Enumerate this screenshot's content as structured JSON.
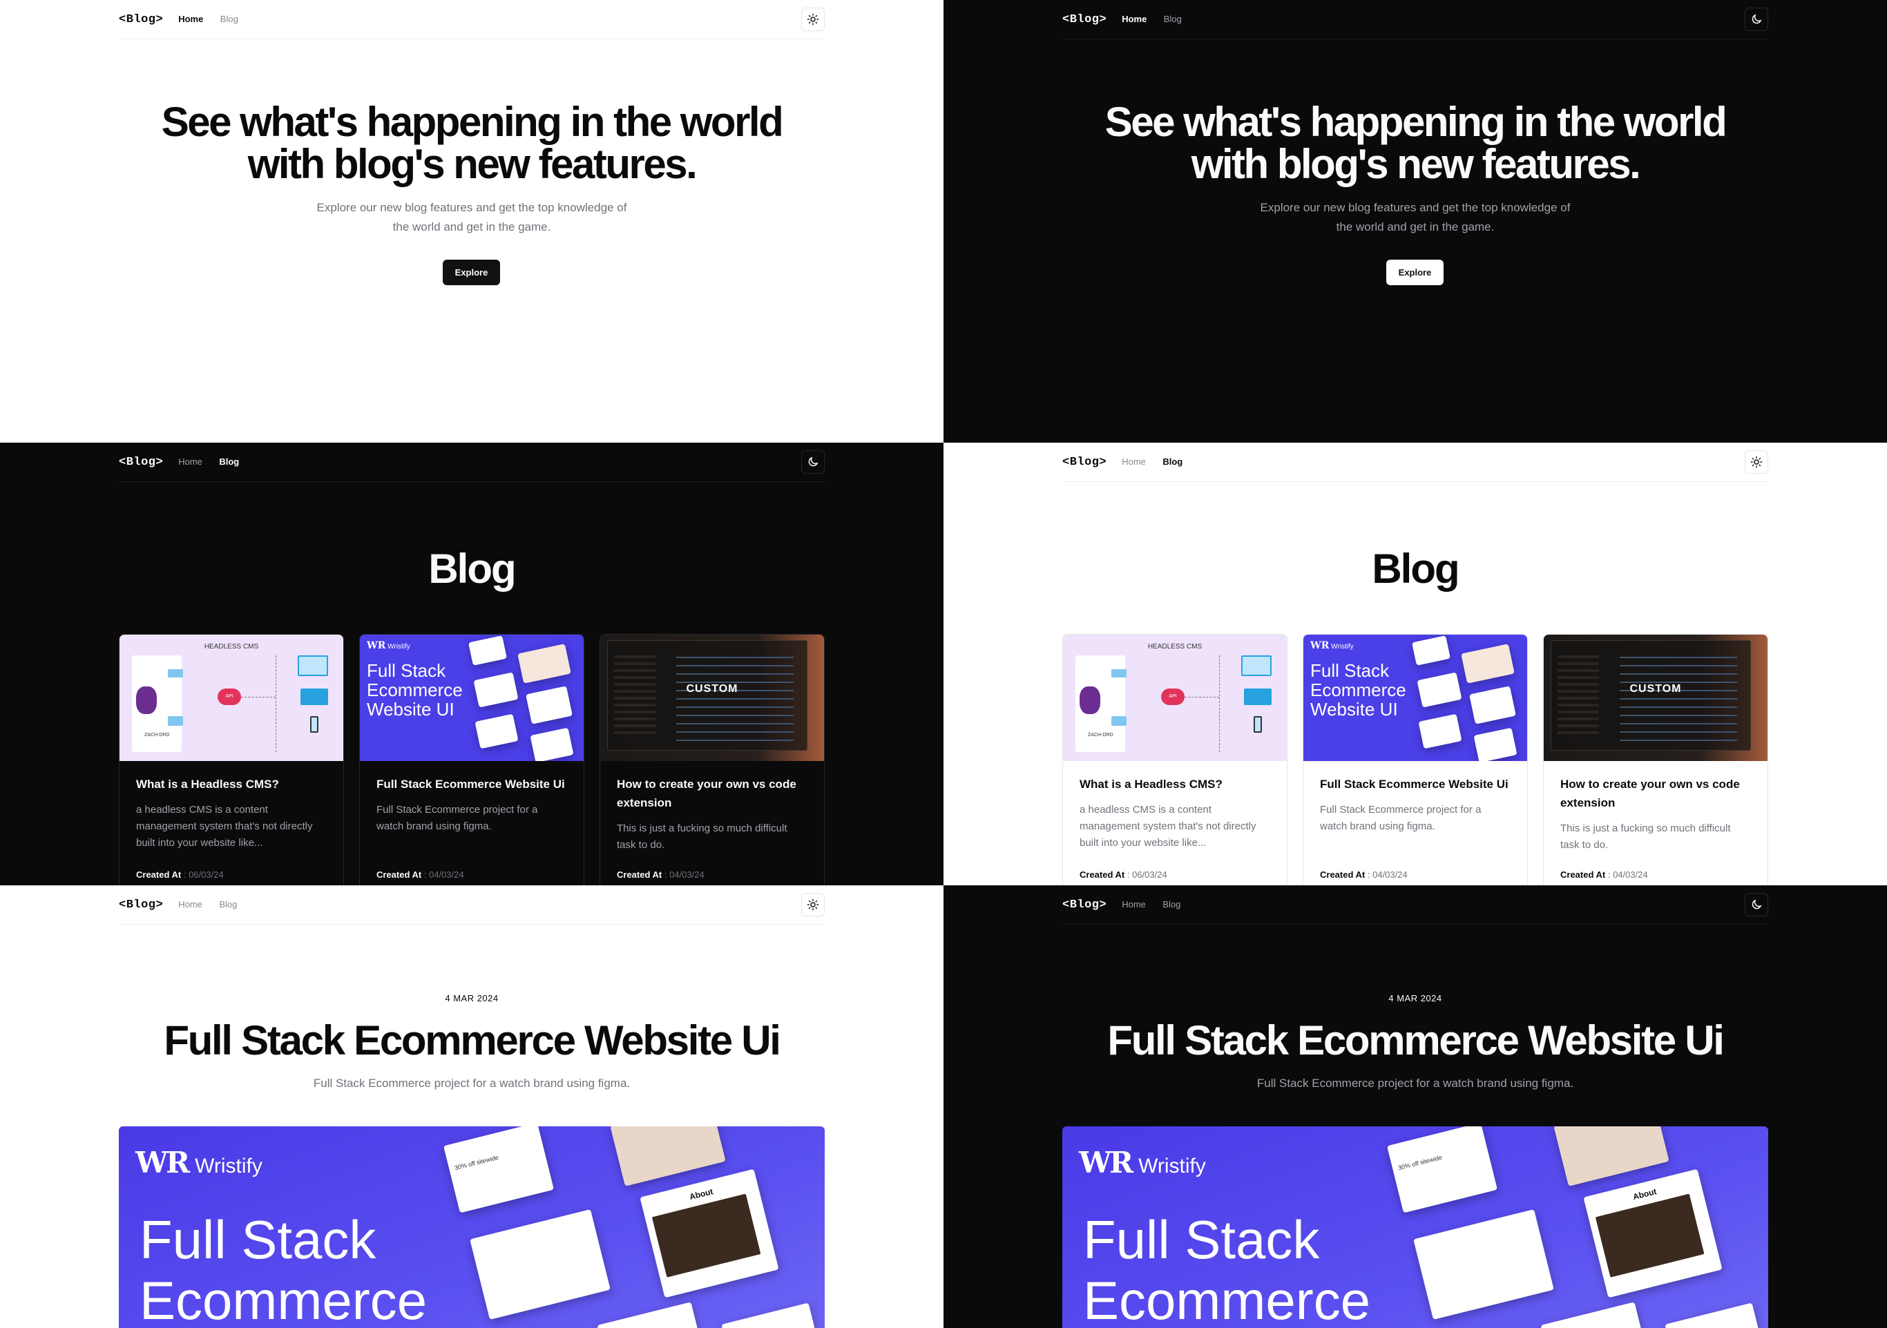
{
  "nav": {
    "logo": "<Blog>",
    "home": "Home",
    "blog": "Blog"
  },
  "hero": {
    "title_line1": "See what's happening in the world",
    "title_line2": "with blog's new features.",
    "sub_line1": "Explore our new blog features and get the top knowledge of",
    "sub_line2": "the world and get in the game.",
    "cta": "Explore"
  },
  "blog": {
    "heading": "Blog",
    "created_label": "Created At",
    "cards": [
      {
        "title": "What is a Headless CMS?",
        "desc": "a headless CMS is a content management system that's not directly built into your website like...",
        "date": "06/03/24",
        "thumb_label": "HEADLESS CMS",
        "thumb_api": "API",
        "thumb_author": "ZACH-DRD"
      },
      {
        "title": "Full Stack Ecommerce Website Ui",
        "desc": "Full Stack Ecommerce project for a watch brand using figma.",
        "date": "04/03/24",
        "thumb_brand": "Wristify",
        "thumb_title": "Full Stack Ecommerce Website UI"
      },
      {
        "title": "How to create your own vs code extension",
        "desc": "This is just a fucking so much difficult task to do.",
        "date": "04/03/24",
        "thumb_label": "CUSTOM"
      }
    ]
  },
  "post": {
    "date": "4 MAR 2024",
    "title": "Full Stack Ecommerce Website Ui",
    "desc": "Full Stack Ecommerce project for a watch brand using figma.",
    "cover_brand": "Wristify",
    "cover_title_line1": "Full Stack",
    "cover_title_line2": "Ecommerce",
    "cover_mock1": "30% off sitewide",
    "cover_mock2": "About"
  },
  "colors": {
    "light_bg": "#ffffff",
    "dark_bg": "#0a0a0b",
    "accent_purple": "#4b3fe8",
    "cms_bg": "#efe3fb",
    "muted_text": "#71717a"
  }
}
